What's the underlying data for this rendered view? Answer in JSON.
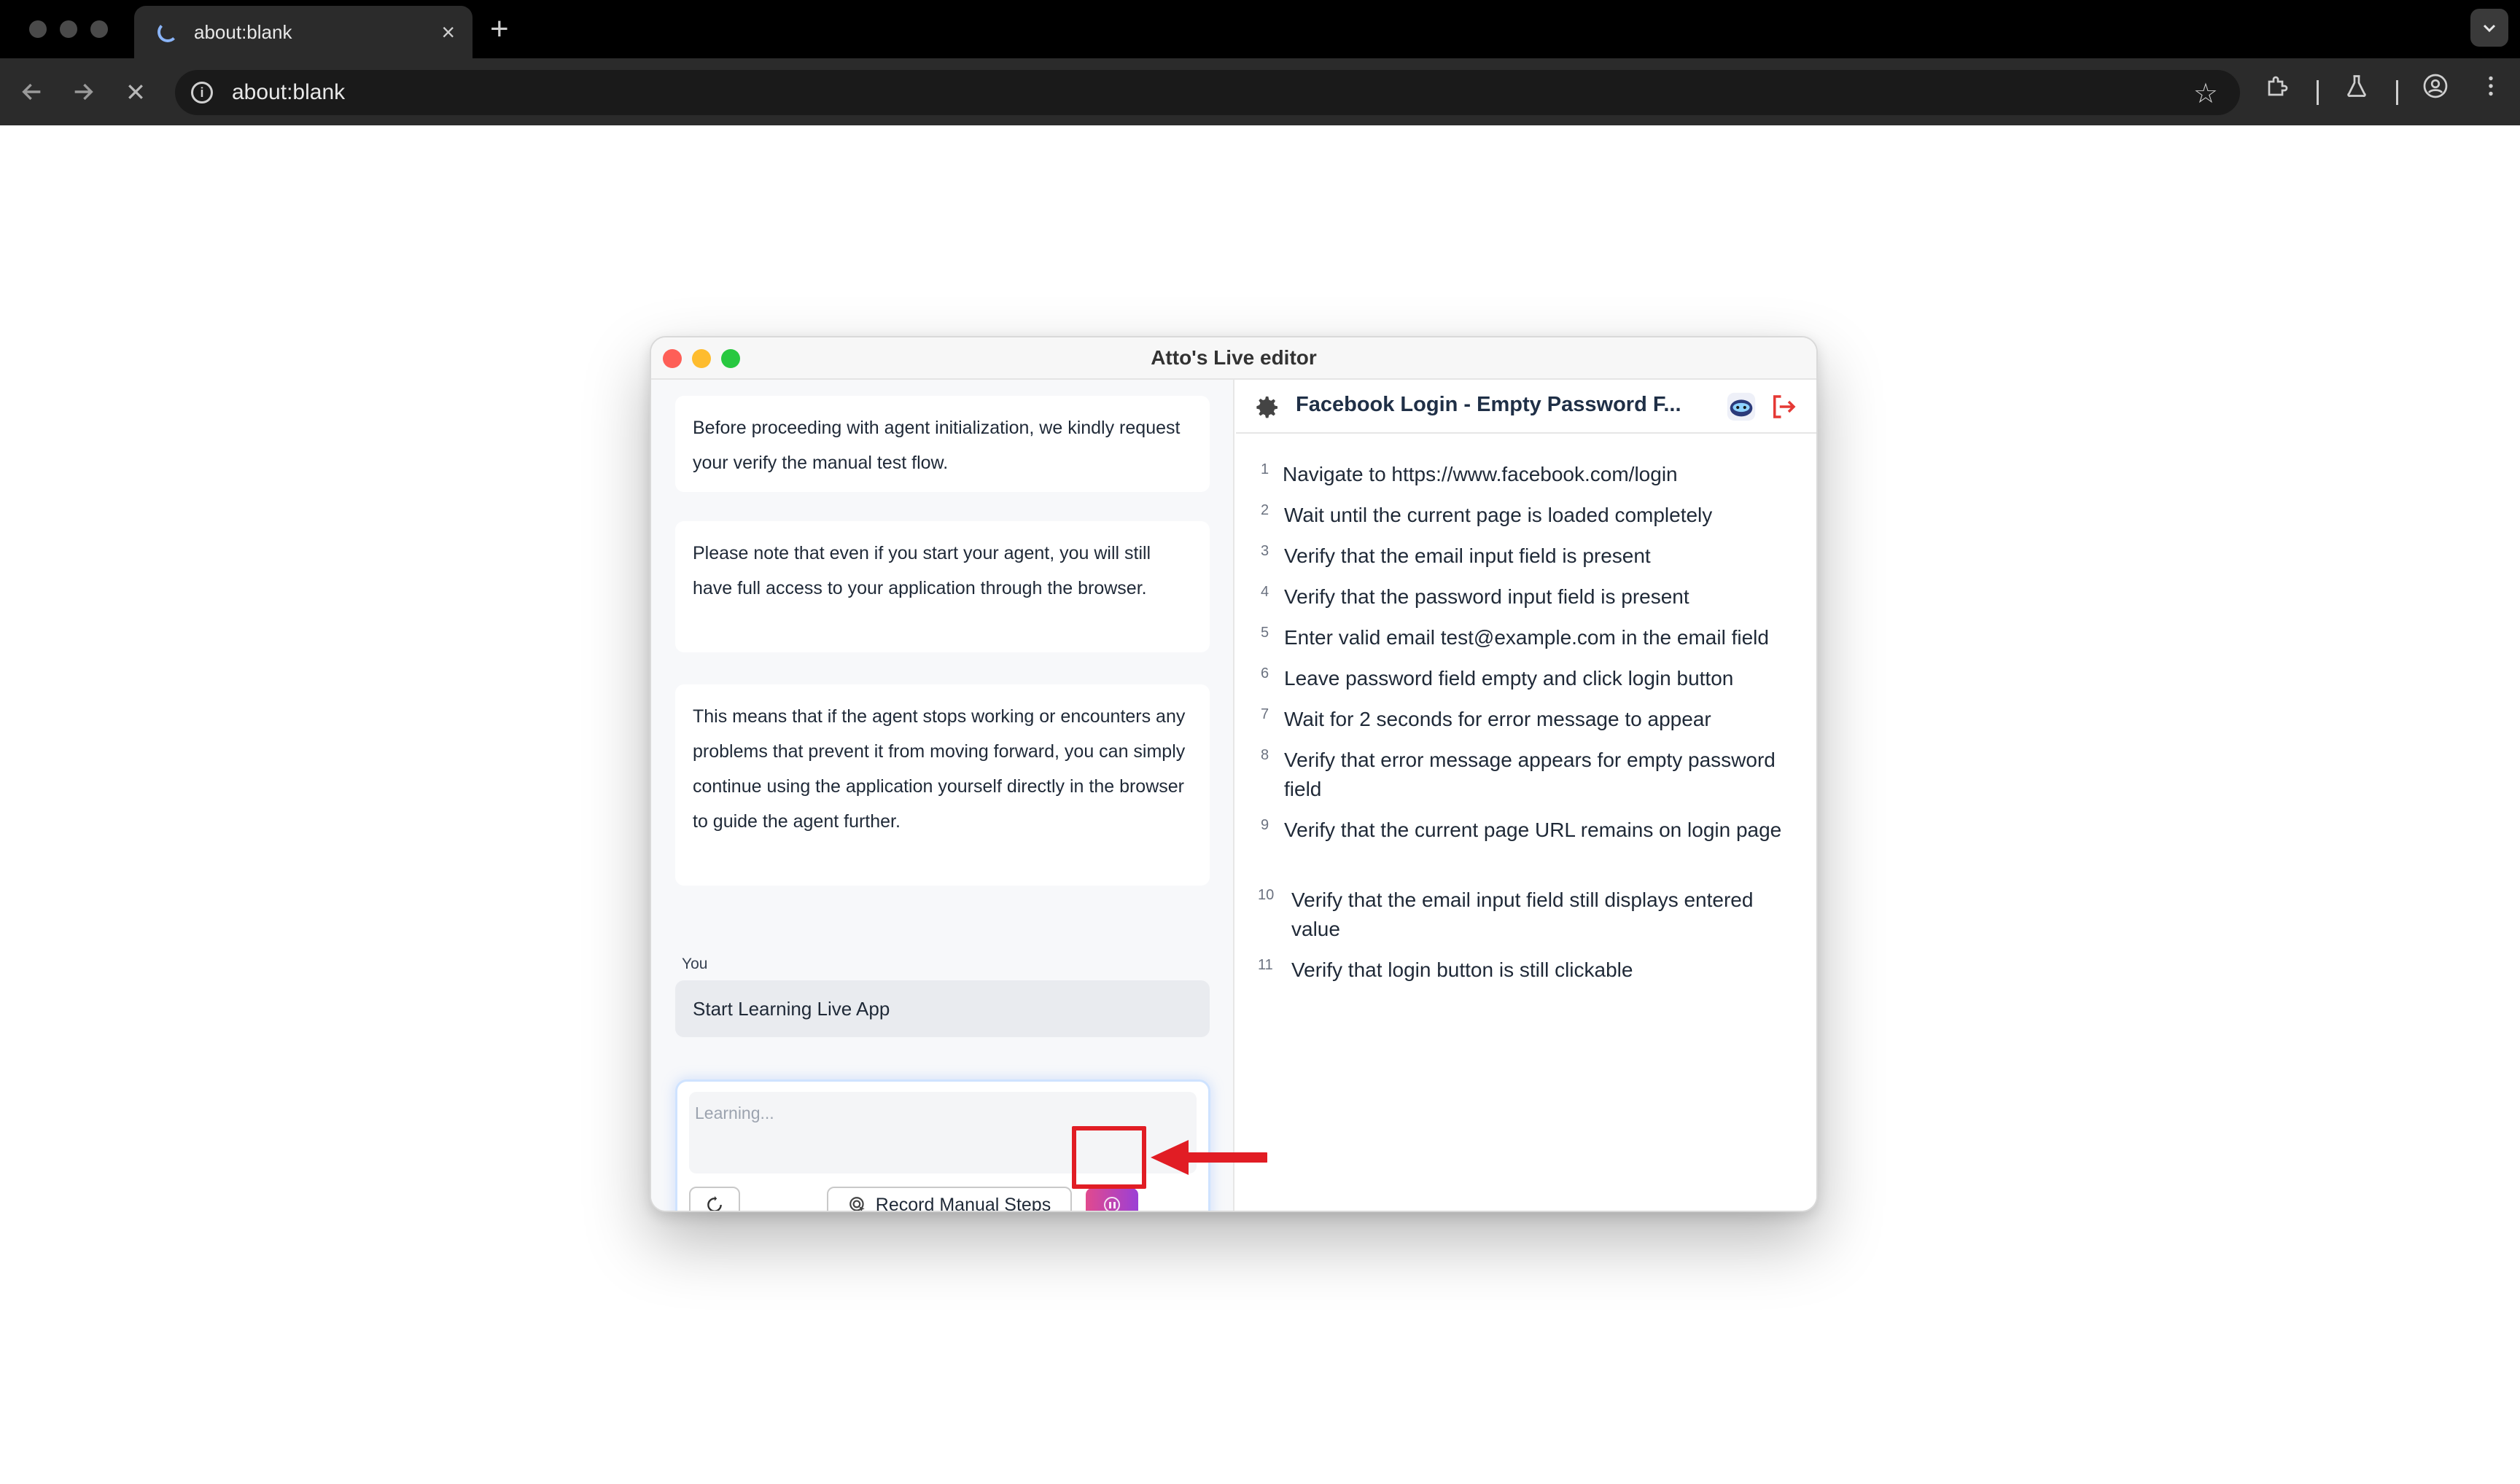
{
  "browser": {
    "tab_title": "about:blank",
    "tab_close_glyph": "×",
    "new_tab_glyph": "+",
    "url": "about:blank",
    "icons": [
      "back-arrow-icon",
      "forward-arrow-icon",
      "stop-loading-icon",
      "site-info-icon",
      "star-icon",
      "extensions-icon",
      "labs-icon",
      "profile-icon",
      "menu-icon"
    ]
  },
  "editor": {
    "window_title": "Atto's Live editor",
    "messages": [
      "Before proceeding with agent initialization, we kindly request your verify the manual test flow.",
      "Please note that even if you start your agent, you will still have full access to your application through the browser.",
      "This means that if the agent stops working or encounters any problems that prevent it from moving forward, you can simply continue using the application yourself directly in the browser to guide the agent further."
    ],
    "you_label": "You",
    "user_message": "Start Learning Live App",
    "composer_placeholder": "Learning...",
    "record_button_label": "Record Manual Steps",
    "test_title": "Facebook Login - Empty Password F...",
    "steps": [
      {
        "num": "1",
        "text": "Navigate to https://www.facebook.com/login"
      },
      {
        "num": "2",
        "text": "Wait until the current page is loaded completely"
      },
      {
        "num": "3",
        "text": "Verify that the email input field is present"
      },
      {
        "num": "4",
        "text": "Verify that the password input field is present"
      },
      {
        "num": "5",
        "text": "Enter valid email test@example.com in the email field"
      },
      {
        "num": "6",
        "text": "Leave password field empty and click login button"
      },
      {
        "num": "7",
        "text": "Wait for 2 seconds for error message to appear"
      },
      {
        "num": "8",
        "text": "Verify that error message appears for empty password field"
      },
      {
        "num": "9",
        "text": "Verify that the current page URL remains on login page"
      },
      {
        "num": "10",
        "text": "Verify that the email input field still displays entered value"
      },
      {
        "num": "11",
        "text": "Verify that login button is still clickable"
      }
    ]
  },
  "colors": {
    "accent_gradient_start": "#e14a8e",
    "accent_gradient_end": "#9b3fd6",
    "annotation_red": "#e11d24",
    "title_navy": "#1f2f46"
  }
}
